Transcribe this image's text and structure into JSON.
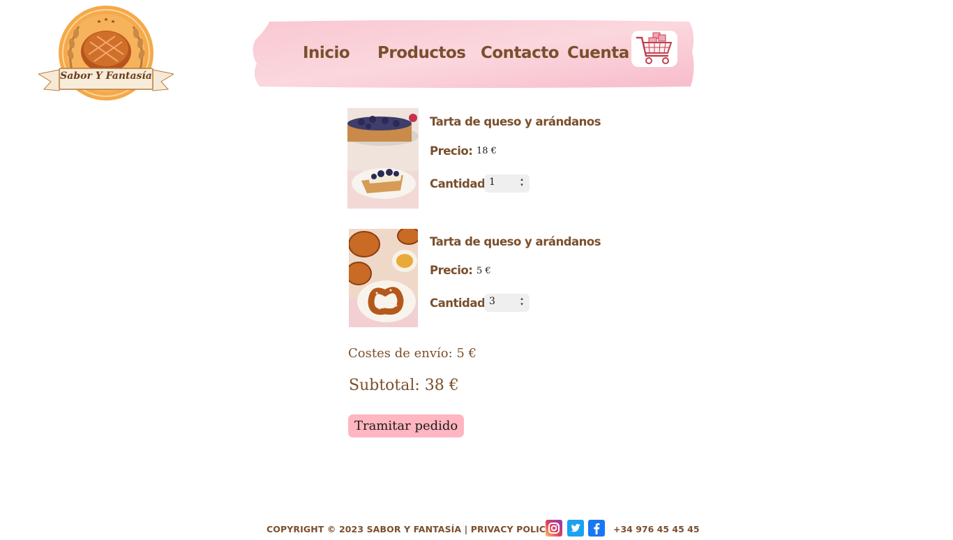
{
  "brand": {
    "name": "Sabor Y Fantasía"
  },
  "nav": {
    "items": [
      {
        "label": "Inicio"
      },
      {
        "label": "Productos"
      },
      {
        "label": "Contacto"
      },
      {
        "label": "Cuenta"
      }
    ],
    "cart_icon": "shopping-cart-icon"
  },
  "cart": {
    "price_label": "Precio:",
    "qty_label": "Cantidad:",
    "items": [
      {
        "name": "Tarta de queso y arándanos",
        "price": "18 €",
        "quantity": "1",
        "image": "blueberry-cheesecake"
      },
      {
        "name": "Tarta de queso y arándanos",
        "price": "5 €",
        "quantity": "3",
        "image": "pretzel-pastries"
      }
    ],
    "shipping": "Costes de envío: 5 €",
    "subtotal": "Subtotal: 38 €",
    "checkout_label": "Tramitar pedido"
  },
  "footer": {
    "copyright": "COPYRIGHT © 2023 SABOR Y FANTASÍA | PRIVACY POLICY",
    "phone": "+34 976 45 45 45",
    "social": [
      {
        "icon": "instagram-icon",
        "color": "#d62976"
      },
      {
        "icon": "twitter-icon",
        "color": "#1da1f2"
      },
      {
        "icon": "facebook-icon",
        "color": "#1877f2"
      }
    ]
  },
  "colors": {
    "text_brown": "#7a4f2c",
    "button_pink": "#ffb6c1",
    "nav_pink": "#f8c3cf"
  }
}
